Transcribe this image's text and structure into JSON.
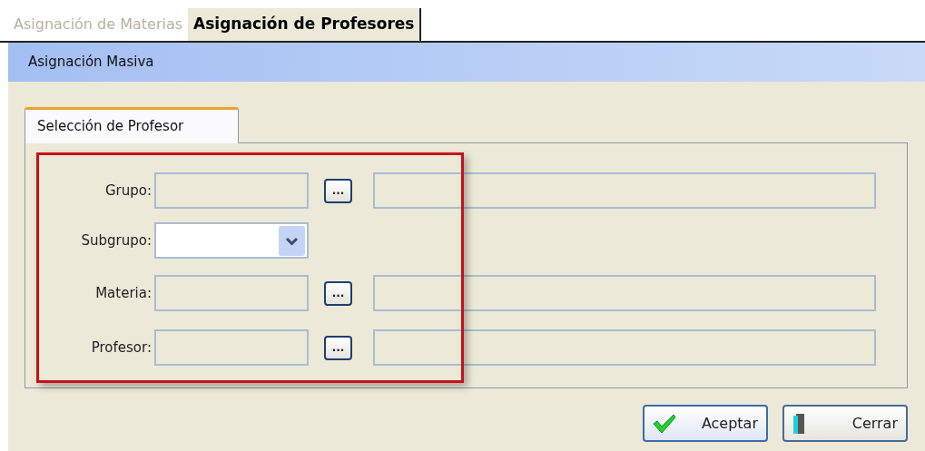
{
  "tabs": [
    {
      "label": "Asignación de Materias",
      "selected": false
    },
    {
      "label": "Asignación de Profesores",
      "selected": true
    }
  ],
  "header": {
    "title": "Asignación Masiva"
  },
  "panel_tabs": [
    {
      "label": "Selección de Profesor",
      "selected": true
    }
  ],
  "fields": [
    {
      "label": "Grupo:",
      "kind": "lookup",
      "button": "..."
    },
    {
      "label": "Subgrupo:",
      "kind": "select"
    },
    {
      "label": "Materia:",
      "kind": "lookup",
      "button": "..."
    },
    {
      "label": "Profesor:",
      "kind": "lookup",
      "button": "..."
    }
  ],
  "buttons": [
    {
      "label": "Aceptar",
      "kind": "ok"
    },
    {
      "label": "Cerrar",
      "kind": "close"
    }
  ]
}
